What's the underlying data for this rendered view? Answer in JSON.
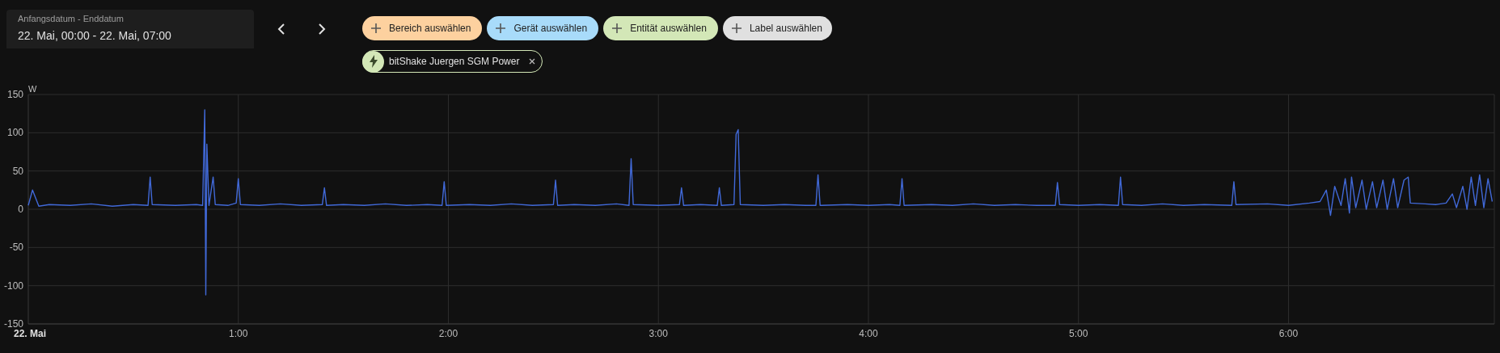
{
  "date_range": {
    "label": "Anfangsdatum - Enddatum",
    "value": "22. Mai, 00:00 - 22. Mai, 07:00"
  },
  "target_buttons": [
    {
      "kind": "area",
      "label": "Bereich auswählen",
      "color": "#fdd19f"
    },
    {
      "kind": "device",
      "label": "Gerät auswählen",
      "color": "#a8dbfa"
    },
    {
      "kind": "entity",
      "label": "Entität auswählen",
      "color": "#d3e7b7"
    },
    {
      "kind": "label",
      "label": "Label auswählen",
      "color": "#e0e0e0"
    }
  ],
  "selected_entities": [
    {
      "label": "bitShake Juergen SGM Power",
      "color": "#d3e7b7"
    }
  ],
  "chart": {
    "x_start_label": "22. Mai",
    "chart_data": {
      "type": "line",
      "ylabel": "W",
      "grid": true,
      "xlim": [
        0,
        6.98
      ],
      "ylim": [
        -150,
        150
      ],
      "xticks": [
        {
          "value": 1,
          "label": "1:00"
        },
        {
          "value": 2,
          "label": "2:00"
        },
        {
          "value": 3,
          "label": "3:00"
        },
        {
          "value": 4,
          "label": "4:00"
        },
        {
          "value": 5,
          "label": "5:00"
        },
        {
          "value": 6,
          "label": "6:00"
        }
      ],
      "yticks": [
        -150,
        -100,
        -50,
        0,
        50,
        100,
        150
      ],
      "x": [
        0,
        0.02,
        0.05,
        0.1,
        0.2,
        0.3,
        0.4,
        0.5,
        0.57,
        0.58,
        0.59,
        0.7,
        0.8,
        0.83,
        0.84,
        0.845,
        0.85,
        0.86,
        0.88,
        0.89,
        0.95,
        0.99,
        1.0,
        1.01,
        1.1,
        1.2,
        1.3,
        1.4,
        1.41,
        1.42,
        1.5,
        1.6,
        1.7,
        1.8,
        1.9,
        1.97,
        1.98,
        1.99,
        2.1,
        2.2,
        2.3,
        2.4,
        2.5,
        2.51,
        2.52,
        2.6,
        2.7,
        2.8,
        2.86,
        2.87,
        2.88,
        3.0,
        3.1,
        3.11,
        3.12,
        3.2,
        3.28,
        3.29,
        3.3,
        3.36,
        3.37,
        3.38,
        3.39,
        3.5,
        3.6,
        3.7,
        3.75,
        3.76,
        3.77,
        3.9,
        4.0,
        4.1,
        4.15,
        4.16,
        4.17,
        4.3,
        4.4,
        4.5,
        4.6,
        4.7,
        4.8,
        4.89,
        4.9,
        4.91,
        5.0,
        5.1,
        5.19,
        5.2,
        5.21,
        5.3,
        5.4,
        5.5,
        5.6,
        5.73,
        5.74,
        5.75,
        5.9,
        6.0,
        6.1,
        6.15,
        6.18,
        6.2,
        6.22,
        6.25,
        6.27,
        6.29,
        6.3,
        6.32,
        6.35,
        6.37,
        6.4,
        6.42,
        6.45,
        6.47,
        6.5,
        6.52,
        6.55,
        6.57,
        6.58,
        6.65,
        6.7,
        6.75,
        6.78,
        6.8,
        6.83,
        6.85,
        6.87,
        6.89,
        6.91,
        6.93,
        6.95,
        6.97
      ],
      "series": [
        {
          "color": "#4169d8",
          "values": [
            5,
            25,
            4,
            6,
            5,
            7,
            4,
            6,
            5,
            42,
            6,
            5,
            6,
            5,
            130,
            -112,
            85,
            5,
            42,
            6,
            5,
            8,
            40,
            6,
            5,
            7,
            5,
            6,
            28,
            5,
            6,
            5,
            7,
            5,
            6,
            5,
            36,
            5,
            6,
            5,
            7,
            5,
            6,
            38,
            5,
            6,
            5,
            7,
            5,
            66,
            6,
            5,
            6,
            28,
            5,
            6,
            5,
            28,
            5,
            6,
            98,
            104,
            6,
            5,
            6,
            5,
            5,
            45,
            5,
            6,
            5,
            6,
            5,
            40,
            5,
            6,
            5,
            7,
            5,
            6,
            5,
            5,
            35,
            6,
            5,
            6,
            5,
            42,
            6,
            5,
            7,
            5,
            6,
            5,
            36,
            6,
            7,
            5,
            8,
            10,
            25,
            -8,
            30,
            5,
            40,
            -5,
            42,
            2,
            38,
            0,
            36,
            2,
            38,
            0,
            40,
            2,
            38,
            42,
            8,
            7,
            6,
            8,
            20,
            2,
            30,
            0,
            42,
            5,
            45,
            2,
            40,
            10
          ]
        }
      ]
    }
  }
}
